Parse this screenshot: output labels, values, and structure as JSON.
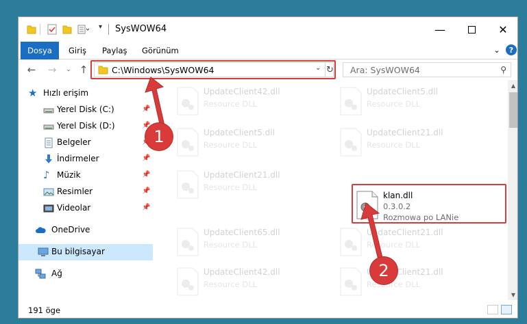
{
  "window": {
    "title": "SysWOW64"
  },
  "ribbon": {
    "tabs": [
      "Dosya",
      "Giriş",
      "Paylaş",
      "Görünüm"
    ]
  },
  "navbar": {
    "address": "C:\\Windows\\SysWOW64",
    "search_placeholder": "Ara: SysWOW64"
  },
  "sidebar": {
    "items": [
      {
        "label": "Hızlı erişim",
        "icon": "star-icon"
      },
      {
        "label": "Yerel Disk (C:)",
        "icon": "drive-icon",
        "pinned": true
      },
      {
        "label": "Yerel Disk (D:)",
        "icon": "drive-icon",
        "pinned": true
      },
      {
        "label": "Belgeler",
        "icon": "documents-icon",
        "pinned": true
      },
      {
        "label": "İndirmeler",
        "icon": "download-icon",
        "pinned": true
      },
      {
        "label": "Müzik",
        "icon": "music-icon",
        "pinned": true
      },
      {
        "label": "Resimler",
        "icon": "pictures-icon",
        "pinned": true
      },
      {
        "label": "Videolar",
        "icon": "videos-icon",
        "pinned": true
      },
      {
        "label": "OneDrive",
        "icon": "cloud-icon"
      },
      {
        "label": "Bu bilgisayar",
        "icon": "computer-icon",
        "selected": true
      },
      {
        "label": "Ağ",
        "icon": "network-icon"
      }
    ]
  },
  "files": [
    {
      "name": "UpdateClient42.dll",
      "desc": "Resource DLL",
      "faded": true
    },
    {
      "name": "UpdateClient5.dll",
      "desc": "Resource DLL",
      "faded": true
    },
    {
      "name": "UpdateClient5.dll",
      "desc": "Resource DLL",
      "faded": true
    },
    {
      "name": "UpdateClient21.dll",
      "desc": "Resource DLL",
      "faded": true
    },
    {
      "name": "UpdateClient21.dll",
      "desc": "Resource DLL",
      "faded": true
    },
    {
      "name": "klan.dll",
      "version": "0.3.0.2",
      "desc": "Rozmowa po LANie",
      "faded": false
    },
    {
      "name": "UpdateClient65.dll",
      "desc": "Resource DLL",
      "faded": true
    },
    {
      "name": "UpdateClient21.dll",
      "desc": "Resource DLL",
      "faded": true
    },
    {
      "name": "UpdateClient42.dll",
      "desc": "Resource DLL",
      "faded": true
    },
    {
      "name": "UpdateClient21.dll",
      "desc": "Resource DLL",
      "faded": true
    }
  ],
  "status": {
    "count": "191 öge"
  },
  "annotations": {
    "badge1": "1",
    "badge2": "2"
  },
  "colors": {
    "accent": "#1a6fc4",
    "highlight": "#d93a3a",
    "selected": "#cce8ff"
  }
}
